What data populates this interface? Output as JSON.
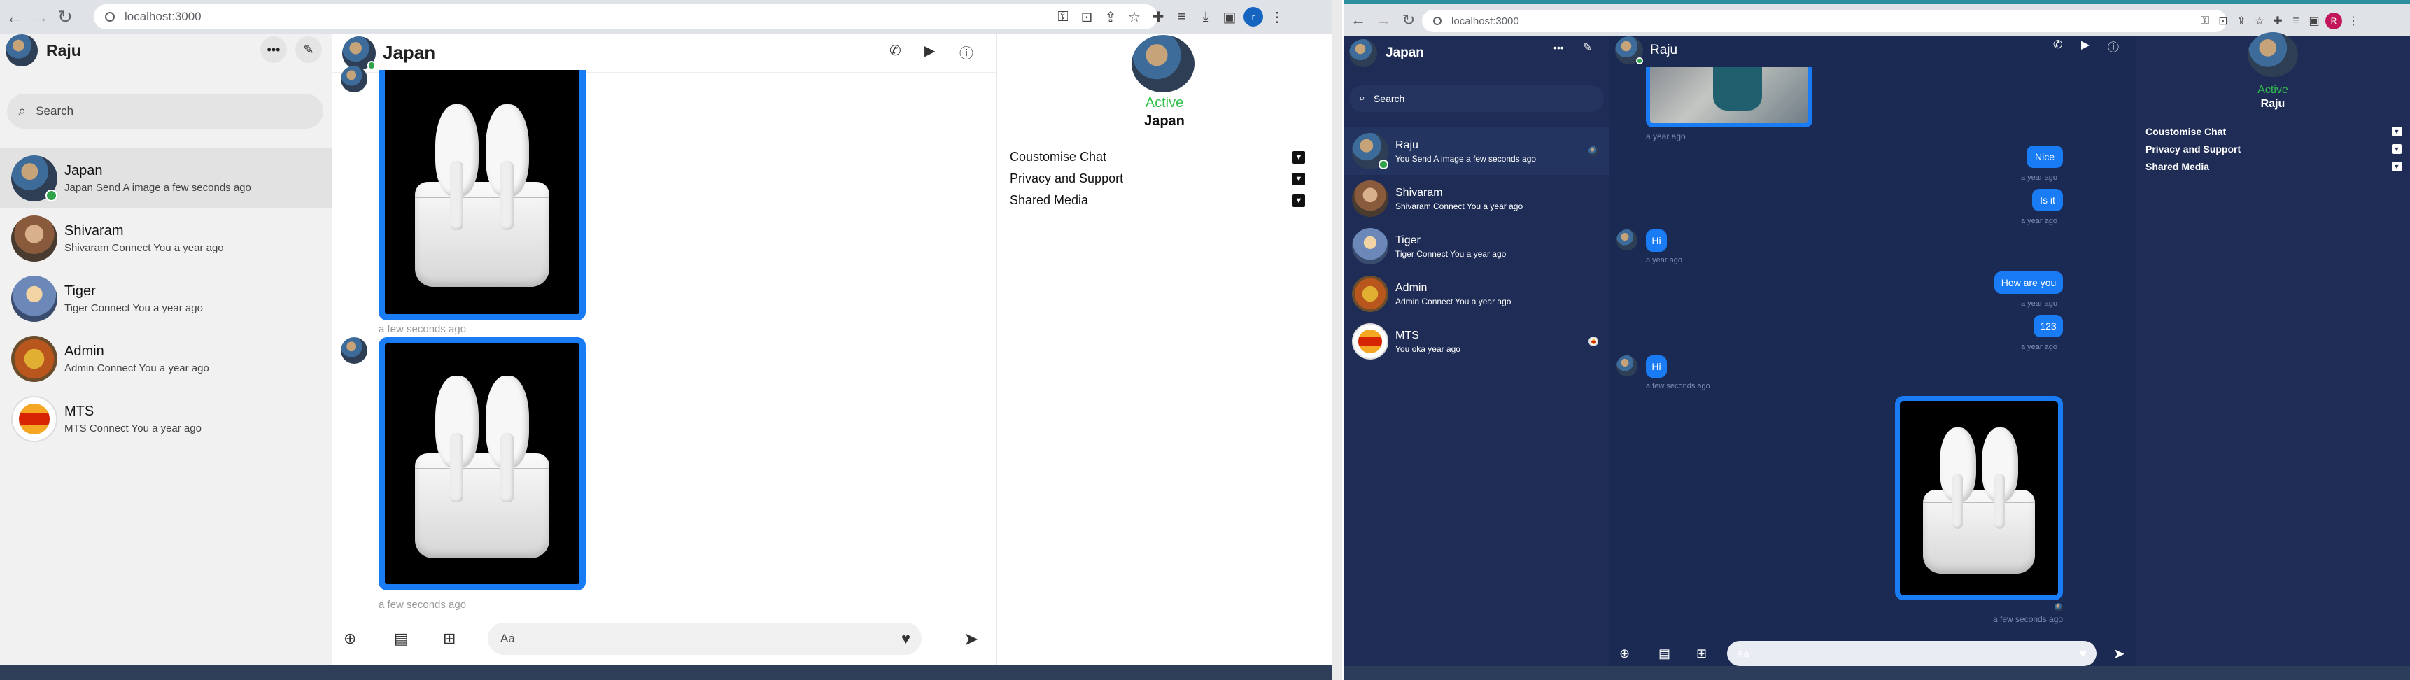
{
  "left_window": {
    "url": "localhost:3000",
    "profile_initial": "r",
    "sidebar": {
      "user_name": "Raju",
      "search_placeholder": "Search",
      "contacts": [
        {
          "name": "Japan",
          "status": "Japan Send A image a few seconds ago"
        },
        {
          "name": "Shivaram",
          "status": "Shivaram Connect You a year ago"
        },
        {
          "name": "Tiger",
          "status": "Tiger Connect You a year ago"
        },
        {
          "name": "Admin",
          "status": "Admin Connect You a year ago"
        },
        {
          "name": "MTS",
          "status": "MTS Connect You a year ago"
        }
      ]
    },
    "chat": {
      "title": "Japan",
      "messages": [
        {
          "type": "image",
          "image": "airpods",
          "time": "a few seconds ago"
        },
        {
          "type": "image",
          "image": "airpods",
          "time": "a few seconds ago"
        }
      ],
      "composer_placeholder": "Aa"
    },
    "details": {
      "status": "Active",
      "name": "Japan",
      "sections": [
        "Coustomise Chat",
        "Privacy and Support",
        "Shared Media"
      ]
    }
  },
  "right_window": {
    "url": "localhost:3000",
    "profile_initial": "R",
    "sidebar": {
      "user_name": "Japan",
      "search_placeholder": "Search",
      "contacts": [
        {
          "name": "Raju",
          "status": "You Send A image a few seconds ago"
        },
        {
          "name": "Shivaram",
          "status": "Shivaram Connect You a year ago"
        },
        {
          "name": "Tiger",
          "status": "Tiger Connect You a year ago"
        },
        {
          "name": "Admin",
          "status": "Admin Connect You a year ago"
        },
        {
          "name": "MTS",
          "status": "You oka year ago"
        }
      ]
    },
    "chat": {
      "title": "Raju",
      "messages": [
        {
          "type": "image",
          "image": "photo",
          "time": "a year ago"
        },
        {
          "type": "text",
          "from": "me",
          "text": "Nice",
          "time": "a year ago"
        },
        {
          "type": "text",
          "from": "me",
          "text": "Is it",
          "time": "a year ago"
        },
        {
          "type": "text",
          "from": "them",
          "text": "Hi",
          "time": "a year ago"
        },
        {
          "type": "text",
          "from": "me",
          "text": "How are you",
          "time": "a year ago"
        },
        {
          "type": "text",
          "from": "me",
          "text": "123",
          "time": "a year ago"
        },
        {
          "type": "text",
          "from": "them",
          "text": "Hi",
          "time": "a few seconds ago"
        },
        {
          "type": "image",
          "from": "me",
          "image": "airpods",
          "time": "a few seconds ago"
        }
      ],
      "composer_placeholder": "Aa"
    },
    "details": {
      "status": "Active",
      "name": "Raju",
      "sections": [
        "Coustomise Chat",
        "Privacy and Support",
        "Shared Media"
      ]
    }
  },
  "colors": {
    "accent": "#1a7cf5",
    "active": "#31a24c",
    "dark_bg": "#1b2a52"
  }
}
